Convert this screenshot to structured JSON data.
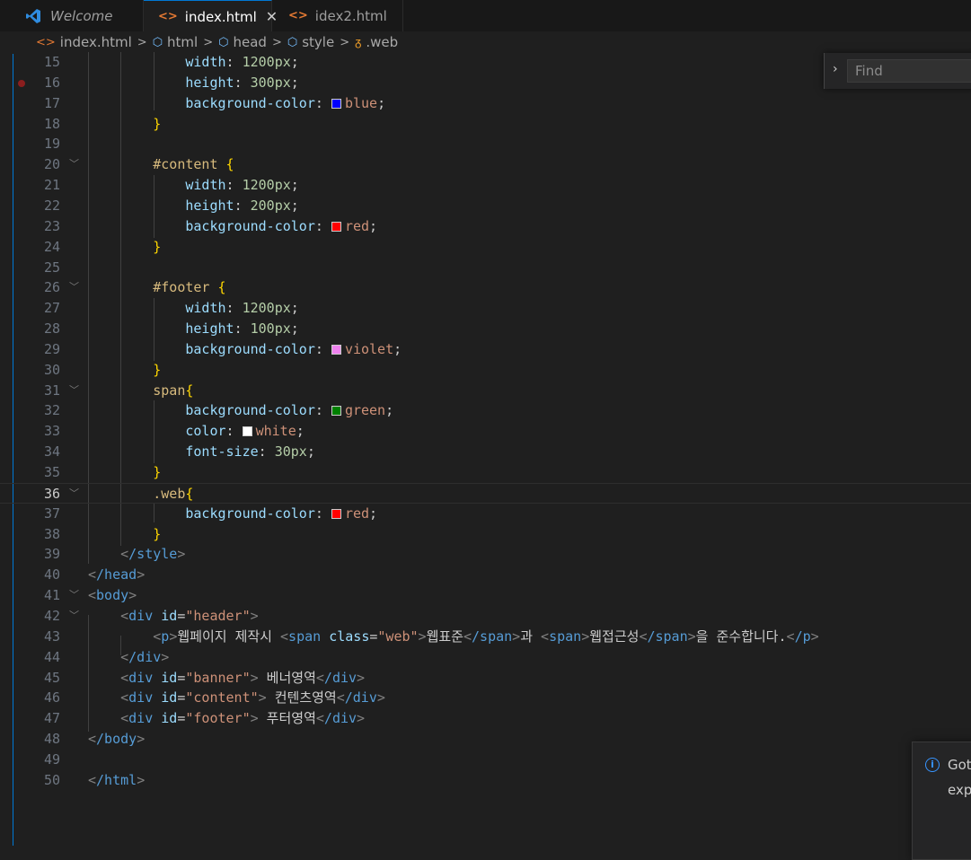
{
  "tabs": [
    {
      "label": "Welcome",
      "icon": "vscode-logo-icon"
    },
    {
      "label": "index.html",
      "icon": "html-file-icon",
      "close": "✕"
    },
    {
      "label": "idex2.html",
      "icon": "html-file-icon"
    }
  ],
  "breadcrumb": {
    "file": "index.html",
    "items": [
      "html",
      "head",
      "style",
      ".web"
    ]
  },
  "left_stub": "ф",
  "find": {
    "placeholder": "Find",
    "toggle": "›"
  },
  "notification": {
    "line1": "Got",
    "line2": "expe"
  },
  "editor": {
    "active_line": 36,
    "breakpoint_line": 16,
    "lines": {
      "15": {
        "prop": "width",
        "value": "1200px"
      },
      "16": {
        "prop": "height",
        "value": "300px"
      },
      "17": {
        "prop": "background-color",
        "value": "blue",
        "swatch": "#0000ff"
      },
      "18": {
        "brace": "}"
      },
      "20": {
        "selector": "#content",
        "brace": "{"
      },
      "21": {
        "prop": "width",
        "value": "1200px"
      },
      "22": {
        "prop": "height",
        "value": "200px"
      },
      "23": {
        "prop": "background-color",
        "value": "red",
        "swatch": "#ff0000"
      },
      "24": {
        "brace": "}"
      },
      "26": {
        "selector": "#footer",
        "brace": "{"
      },
      "27": {
        "prop": "width",
        "value": "1200px"
      },
      "28": {
        "prop": "height",
        "value": "100px"
      },
      "29": {
        "prop": "background-color",
        "value": "violet",
        "swatch": "#ee82ee"
      },
      "30": {
        "brace": "}"
      },
      "31": {
        "selector": "span",
        "brace": "{"
      },
      "32": {
        "prop": "background-color",
        "value": "green",
        "swatch": "#008000"
      },
      "33": {
        "prop": "color",
        "value": "white",
        "swatch": "#ffffff"
      },
      "34": {
        "prop": "font-size",
        "value": "30px"
      },
      "35": {
        "brace": "}"
      },
      "36": {
        "selector": ".web",
        "brace": "{"
      },
      "37": {
        "prop": "background-color",
        "value": "red",
        "swatch": "#ff0000"
      },
      "38": {
        "brace": "}"
      },
      "39": {
        "tag": "/style"
      },
      "40": {
        "tag": "/head"
      },
      "41": {
        "tag": "body"
      },
      "42": {
        "tag": "div",
        "attr": "id",
        "val": "\"header\""
      },
      "43": {
        "p_open": "p",
        "t1": "웹페이지 제작시 ",
        "span_tag": "span",
        "span_attr": "class",
        "span_val": "\"web\"",
        "t2": "웹표준",
        "span_close": "/span",
        "t3": "과 ",
        "span_tag2": "span",
        "t4": "웹접근성",
        "span_close2": "/span",
        "t5": "을 준수합니다.",
        "p_close": "/p"
      },
      "44": {
        "tag": "/div"
      },
      "45": {
        "tag": "div",
        "attr": "id",
        "val": "\"banner\"",
        "text": " 베너영역",
        "close": "/div"
      },
      "46": {
        "tag": "div",
        "attr": "id",
        "val": "\"content\"",
        "text": " 컨텐츠영역",
        "close": "/div"
      },
      "47": {
        "tag": "div",
        "attr": "id",
        "val": "\"footer\"",
        "text": " 푸터영역",
        "close": "/div"
      },
      "48": {
        "tag": "/body"
      },
      "50": {
        "tag": "/html"
      }
    },
    "numbers": [
      "15",
      "16",
      "17",
      "18",
      "19",
      "20",
      "21",
      "22",
      "23",
      "24",
      "25",
      "26",
      "27",
      "28",
      "29",
      "30",
      "31",
      "32",
      "33",
      "34",
      "35",
      "36",
      "37",
      "38",
      "39",
      "40",
      "41",
      "42",
      "43",
      "44",
      "45",
      "46",
      "47",
      "48",
      "49",
      "50"
    ]
  },
  "colors": {
    "accent": "#0078d4",
    "background": "#1f1f1f"
  }
}
